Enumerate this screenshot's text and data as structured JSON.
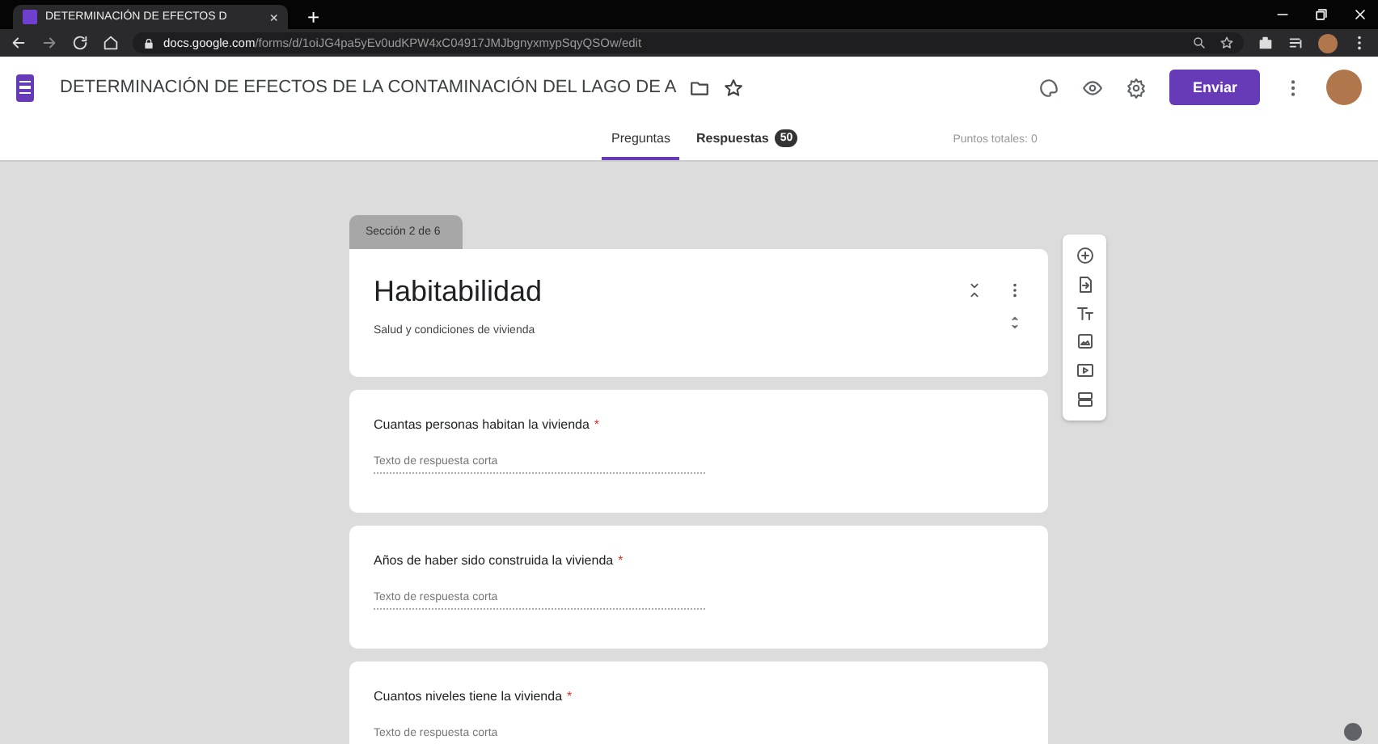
{
  "browser": {
    "tab": {
      "title": "DETERMINACIÓN DE EFECTOS D",
      "close": "×"
    },
    "new_tab": "+",
    "url_host": "docs.google.com",
    "url_path": "/forms/d/1oiJG4pa5yEv0udKPW4xC04917JMJbgnyxmypSqyQSOw/edit"
  },
  "form_header": {
    "title": "DETERMINACIÓN DE EFECTOS DE LA CONTAMINACIÓN DEL LAGO DE A",
    "send": "Enviar"
  },
  "tabs": [
    {
      "label": "Preguntas",
      "selected": true
    },
    {
      "label": "Respuestas",
      "selected": false,
      "badge": "50"
    }
  ],
  "total_points": "Puntos totales: 0",
  "section": {
    "tag": "Sección 2 de 6",
    "title": "Habitabilidad",
    "description": "Salud y condiciones de vivienda"
  },
  "questions": [
    {
      "title": "Cuantas personas habitan la vivienda",
      "required_mark": "*",
      "placeholder": "Texto de respuesta corta"
    },
    {
      "title": "Años de haber sido construida la vivienda",
      "required_mark": "*",
      "placeholder": "Texto de respuesta corta"
    },
    {
      "title": "Cuantos niveles tiene la vivienda",
      "required_mark": "*",
      "placeholder": "Texto de respuesta corta"
    }
  ]
}
